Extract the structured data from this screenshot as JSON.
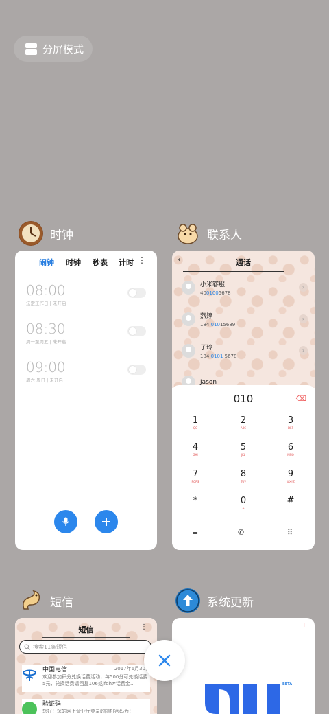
{
  "split_mode": {
    "label": "分屏模式"
  },
  "clock": {
    "app_name": "时钟",
    "tabs": [
      "闹钟",
      "时钟",
      "秒表",
      "计时"
    ],
    "alarms": [
      {
        "time": "08:00",
        "sub": "法定工作日 | 未开启"
      },
      {
        "time": "08:30",
        "sub": "周一至周五 | 未开启"
      },
      {
        "time": "09:00",
        "sub": "周六 周日 | 未开启"
      }
    ]
  },
  "contacts": {
    "app_name": "联系人",
    "title": "通话",
    "list": [
      {
        "name": "小米客服",
        "num_pre": "40",
        "num_hl": "0100",
        "num_post": "5678"
      },
      {
        "name": "燕婷",
        "num_pre": "184 ",
        "num_hl": "010",
        "num_post": "15689"
      },
      {
        "name": "子玲",
        "num_pre": "184 ",
        "num_hl": "0101",
        "num_post": " 5678"
      },
      {
        "name": "Jason",
        "num_pre": "",
        "num_hl": "",
        "num_post": ""
      }
    ],
    "dial_input": "010",
    "keys": [
      {
        "d": "1",
        "l": "QO"
      },
      {
        "d": "2",
        "l": "ABC"
      },
      {
        "d": "3",
        "l": "DEF"
      },
      {
        "d": "4",
        "l": "GHI"
      },
      {
        "d": "5",
        "l": "JKL"
      },
      {
        "d": "6",
        "l": "MNO"
      },
      {
        "d": "7",
        "l": "PQRS"
      },
      {
        "d": "8",
        "l": "TUV"
      },
      {
        "d": "9",
        "l": "WXYZ"
      },
      {
        "d": "*",
        "l": ""
      },
      {
        "d": "0",
        "l": "+"
      },
      {
        "d": "#",
        "l": ""
      }
    ]
  },
  "messages": {
    "app_name": "短信",
    "title": "短信",
    "search_placeholder": "搜索11条短信",
    "items": [
      {
        "name": "中国电信",
        "date": "2017年6月30日",
        "body": "欢迎参加积分兑换话费活动，每500分可兑换话费5元，兑换话费请回复106或jfdh#话费金..."
      },
      {
        "name": "验证码",
        "date": "",
        "body": "您好！您的网上营业厅登录的随机密码为："
      }
    ]
  },
  "update": {
    "app_name": "系统更新",
    "beta": "BETA"
  },
  "colors": {
    "accent": "#2c87ec",
    "background": "#aba7a6"
  }
}
